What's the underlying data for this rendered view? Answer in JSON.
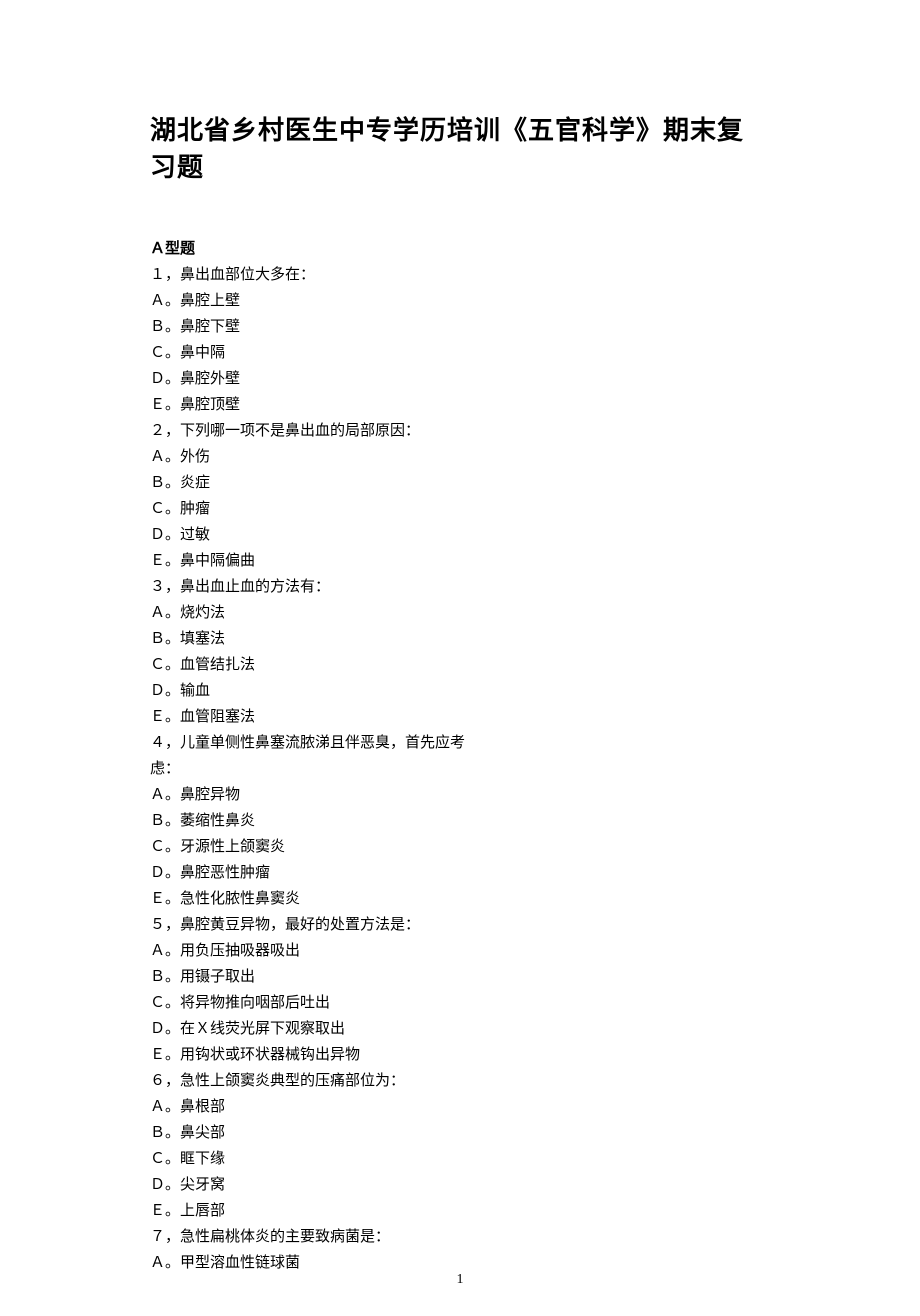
{
  "title": "湖北省乡村医生中专学历培训《五官科学》期末复习题",
  "section_label": "Ａ型题",
  "questions": [
    {
      "stem": "１，鼻出血部位大多在：",
      "options": [
        "Ａ。鼻腔上壁",
        "Ｂ。鼻腔下壁",
        "Ｃ。鼻中隔",
        "Ｄ。鼻腔外壁",
        "Ｅ。鼻腔顶壁"
      ]
    },
    {
      "stem": "２，下列哪一项不是鼻出血的局部原因：",
      "options": [
        "Ａ。外伤",
        "Ｂ。炎症",
        "Ｃ。肿瘤",
        "Ｄ。过敏",
        "Ｅ。鼻中隔偏曲"
      ]
    },
    {
      "stem": "３，鼻出血止血的方法有：",
      "options": [
        "Ａ。烧灼法",
        "Ｂ。填塞法",
        "Ｃ。血管结扎法",
        "Ｄ。输血",
        "Ｅ。血管阻塞法"
      ]
    },
    {
      "stem": "４，儿童单侧性鼻塞流脓涕且伴恶臭，首先应考虑：",
      "options": [
        "Ａ。鼻腔异物",
        "Ｂ。萎缩性鼻炎",
        "Ｃ。牙源性上颌窦炎",
        "Ｄ。鼻腔恶性肿瘤",
        "Ｅ。急性化脓性鼻窦炎"
      ]
    },
    {
      "stem": "５，鼻腔黄豆异物，最好的处置方法是：",
      "options": [
        "Ａ。用负压抽吸器吸出",
        "Ｂ。用镊子取出",
        "Ｃ。将异物推向咽部后吐出",
        "Ｄ。在Ｘ线荧光屏下观察取出",
        "Ｅ。用钩状或环状器械钩出异物"
      ]
    },
    {
      "stem": "６，急性上颌窦炎典型的压痛部位为：",
      "options": [
        "Ａ。鼻根部",
        "Ｂ。鼻尖部",
        "Ｃ。眶下缘",
        "Ｄ。尖牙窝",
        "Ｅ。上唇部"
      ]
    },
    {
      "stem": "７，急性扁桃体炎的主要致病菌是：",
      "options": [
        "Ａ。甲型溶血性链球菌"
      ]
    }
  ],
  "page_number": "1"
}
